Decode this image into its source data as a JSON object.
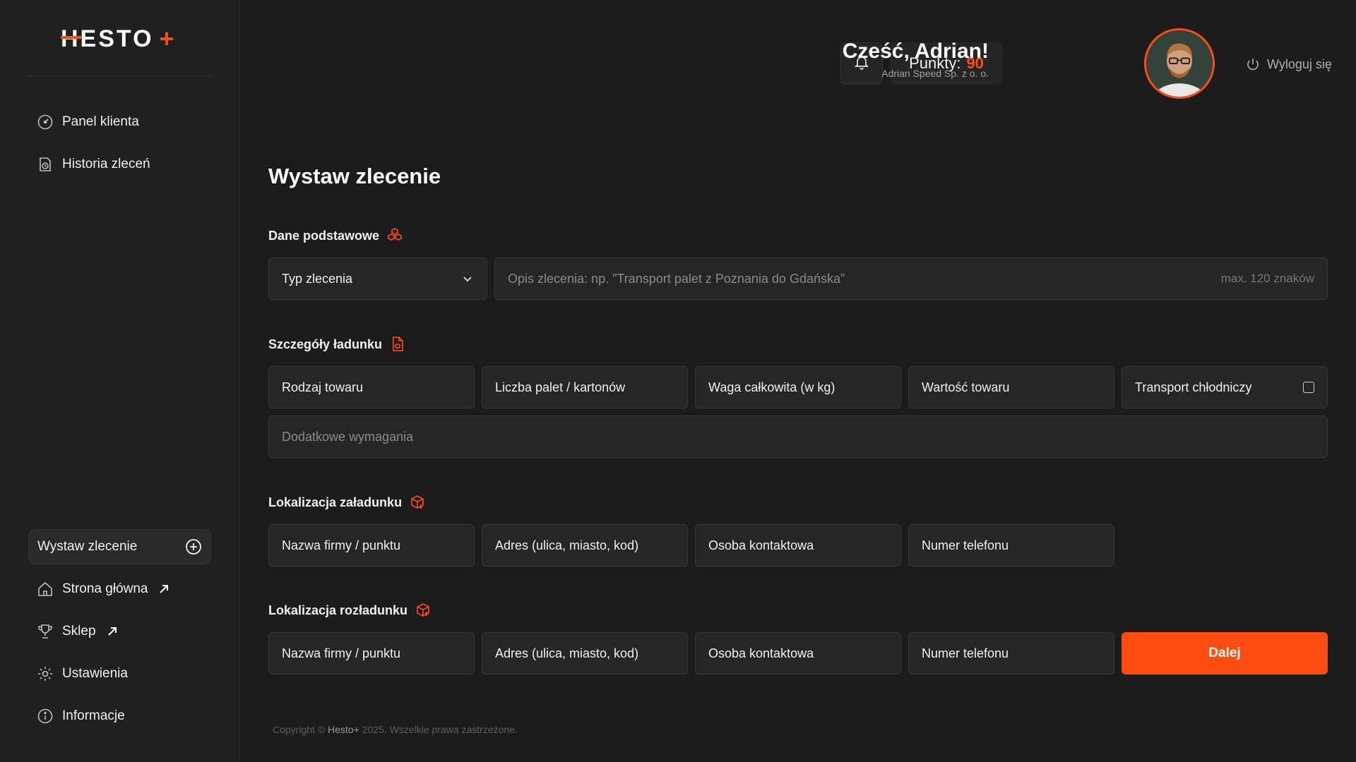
{
  "brand": {
    "logo_text": "HESTO",
    "logo_plus": "+"
  },
  "sidebar": {
    "top_items": [
      {
        "label": "Panel klienta",
        "icon": "gauge-icon"
      },
      {
        "label": "Historia zleceń",
        "icon": "history-icon"
      }
    ],
    "active_item": {
      "label": "Wystaw zlecenie",
      "icon": "plus-circle-icon"
    },
    "bottom_items": [
      {
        "label": "Strona główna",
        "icon": "home-icon",
        "external": true
      },
      {
        "label": "Sklep",
        "icon": "trophy-icon",
        "external": true
      },
      {
        "label": "Ustawienia",
        "icon": "gear-icon"
      },
      {
        "label": "Informacje",
        "icon": "info-icon"
      }
    ]
  },
  "header": {
    "points_label": "Punkty:",
    "points_value": "90",
    "greeting": "Cześć, Adrian!",
    "company": "Adrian Speed Sp. z o. o.",
    "logout_label": "Wyloguj się"
  },
  "main": {
    "title": "Wystaw zlecenie",
    "sections": {
      "basic": {
        "label": "Dane podstawowe",
        "type_select": "Typ zlecenia",
        "description_placeholder": "Opis zlecenia: np. \"Transport palet z Poznania do Gdańska\"",
        "description_hint": "max. 120 znaków"
      },
      "cargo": {
        "label": "Szczegóły ładunku",
        "fields": [
          "Rodzaj towaru",
          "Liczba palet / kartonów",
          "Waga całkowita (w kg)",
          "Wartość towaru",
          "Transport chłodniczy"
        ],
        "extra_placeholder": "Dodatkowe wymagania"
      },
      "loading": {
        "label": "Lokalizacja załadunku",
        "fields": [
          "Nazwa firmy / punktu",
          "Adres (ulica, miasto, kod)",
          "Osoba kontaktowa",
          "Numer telefonu"
        ]
      },
      "unloading": {
        "label": "Lokalizacja rozładunku",
        "fields": [
          "Nazwa firmy / punktu",
          "Adres (ulica, miasto, kod)",
          "Osoba kontaktowa",
          "Numer telefonu"
        ]
      }
    },
    "next_button": "Dalej"
  },
  "footer": {
    "prefix": "Copyright ©",
    "brand": "Hesto+",
    "suffix": "2025. Wszelkie prawa zastrzeżone."
  },
  "colors": {
    "accent": "#ff4d12",
    "background": "#1c1c1c",
    "sidebar": "#202020",
    "field": "#262626"
  }
}
